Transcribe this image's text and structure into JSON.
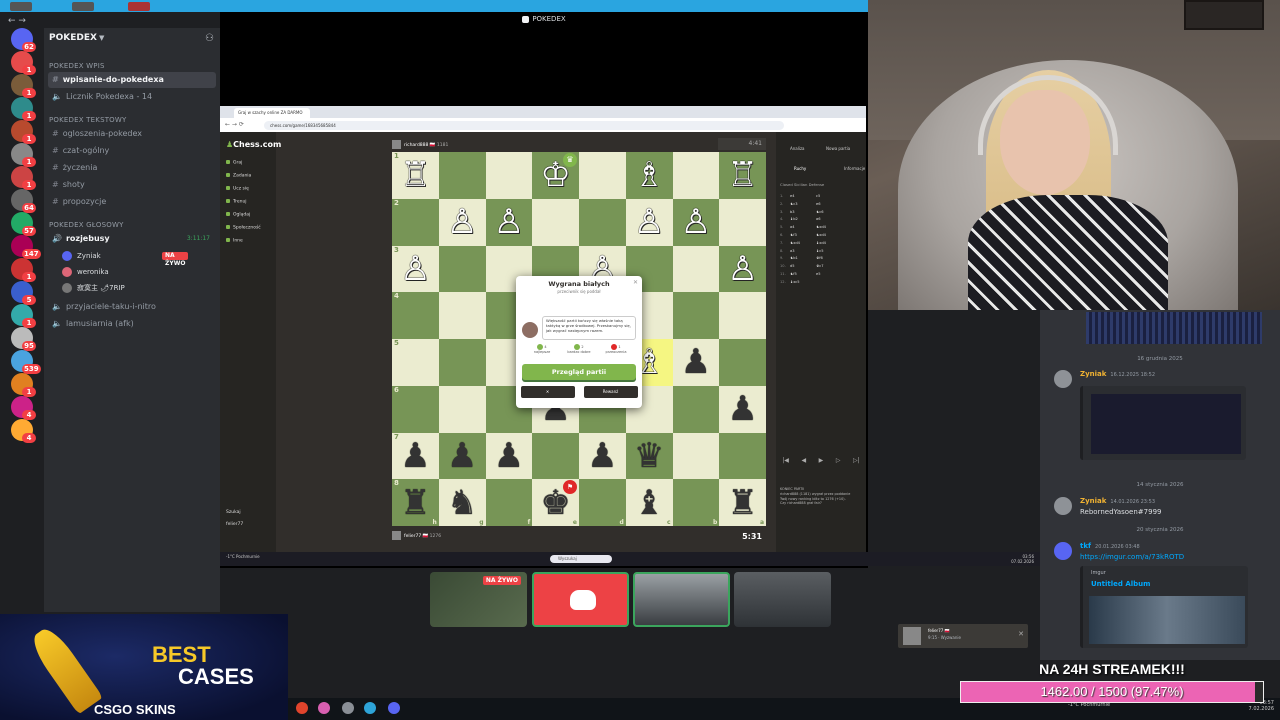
{
  "colors": {
    "discord_bg": "#1e1f22",
    "sidebar": "#2b2d31",
    "chat_bg": "#313338",
    "live_red": "#ed4245",
    "chess_light": "#ebecd0",
    "chess_dark": "#779556",
    "chess_green": "#81b64c",
    "goal_pink": "#ec64b4"
  },
  "server": {
    "name": "POKEDEX"
  },
  "rail_badges": [
    "62",
    "1",
    "1",
    "1",
    "1",
    "1",
    "1",
    "64",
    "57",
    "147",
    "1",
    "5",
    "1",
    "95",
    "539",
    "1",
    "4",
    "4"
  ],
  "categories": {
    "wpis": "POKEDEX Wpis",
    "tekstowy": "POKEDEX Tekstowy",
    "glosowy": "POKEDEX GŁOSOWY"
  },
  "channels": {
    "wpisanie": "wpisanie-do-pokedexa",
    "licznik": "Licznik Pokedexa - 14",
    "ogloszenia": "ogloszenia-pokedex",
    "czat": "czat-ogólny",
    "zyczenia": "życzenia",
    "shoty": "shoty",
    "propozycje": "propozycje",
    "voice": "rozjebusy",
    "voice_timer": "3:11:17",
    "przyjaciele": "przyjaciele-taku-i-nitro",
    "lamusiarnia": "lamusiarnia (afk)"
  },
  "voice_users": [
    {
      "name": "Zyniak",
      "live": "NA ŻYWO"
    },
    {
      "name": "weronika",
      "live": ""
    },
    {
      "name": "寂寞主 🌶7RIP",
      "live": ""
    }
  ],
  "stream": {
    "title": "POKEDEX"
  },
  "browser": {
    "tab_title": "Graj w szachy online ZA DARMO",
    "url": "chess.com/game/168345685844"
  },
  "chess": {
    "logo": "Chess.com",
    "nav": [
      "Graj",
      "Zadania",
      "Ucz się",
      "Trenuj",
      "Oglądaj",
      "Społeczność",
      "Inne"
    ],
    "nav_bottom": [
      "Szukaj",
      "felier77"
    ],
    "top_player": "richard888 🇵🇱",
    "top_rating": "1181",
    "top_clock": "4:41",
    "bottom_player": "felier77 🇵🇱",
    "bottom_rating": "1276",
    "bottom_clock": "5:31",
    "files": [
      "h",
      "g",
      "f",
      "e",
      "d",
      "c",
      "b",
      "a"
    ],
    "board": [
      [
        "♖",
        "",
        "",
        "♔",
        "",
        "♗",
        "",
        "♖"
      ],
      [
        "",
        "♙",
        "♙",
        "",
        "",
        "♙",
        "♙",
        ""
      ],
      [
        "♙",
        "",
        "",
        "",
        "♙",
        "",
        "",
        "♙"
      ],
      [
        "",
        "",
        "",
        "",
        "",
        "",
        "",
        ""
      ],
      [
        "",
        "",
        "",
        "",
        "",
        "♗",
        "♟",
        ""
      ],
      [
        "",
        "",
        "",
        "♟",
        "",
        "",
        "",
        "♟"
      ],
      [
        "♟",
        "♟",
        "♟",
        "",
        "♟",
        "♛",
        "",
        ""
      ],
      [
        "♜",
        "♞",
        "",
        "♚",
        "",
        "♝",
        "",
        "♜"
      ]
    ],
    "board_colors": [
      [
        "w",
        "b",
        "b",
        "w",
        "b",
        "w",
        "b",
        "w"
      ],
      [
        "w",
        "w",
        "w",
        "w",
        "w",
        "w",
        "w",
        "w"
      ],
      [
        "w",
        "w",
        "w",
        "w",
        "w",
        "w",
        "w",
        "w"
      ],
      [
        "",
        "",
        "",
        "",
        "",
        "",
        "",
        ""
      ],
      [
        "",
        "",
        "",
        "",
        "",
        "w",
        "b",
        ""
      ],
      [
        "",
        "",
        "",
        "b",
        "",
        "",
        "",
        "b"
      ],
      [
        "b",
        "b",
        "b",
        "",
        "b",
        "b",
        "",
        ""
      ],
      [
        "b",
        "b",
        "",
        "b",
        "",
        "b",
        "",
        "b"
      ]
    ],
    "modal": {
      "title": "Wygrana białych",
      "subtitle": "przeciwnik się poddał",
      "tip": "Większość partii kończy się właśnie taką taktyką w grze środkowej. Przeskanujmy się, jak wygrać następnym razem.",
      "stats": [
        {
          "value": "4",
          "label": "najlepsze",
          "color": "#81b64c"
        },
        {
          "value": "2",
          "label": "bardzo dobre",
          "color": "#81b64c"
        },
        {
          "value": "1",
          "label": "przeoczenia",
          "color": "#e02828"
        }
      ],
      "review": "Przegląd partii",
      "rematch": "Rewanż"
    },
    "panel": {
      "tab_analysis": "Analiza",
      "tab_new": "Nowa partia",
      "tab_moves": "Ruchy",
      "tab_info": "Informacje",
      "opening": "Closed Sicilian Defense",
      "moves": [
        [
          "1.",
          "e4",
          "c5"
        ],
        [
          "2.",
          "♞c3",
          "e6"
        ],
        [
          "3.",
          "b3",
          "♞c6"
        ],
        [
          "4.",
          "♝b2",
          "a6"
        ],
        [
          "5.",
          "a4",
          "♞xd4"
        ],
        [
          "6.",
          "♞f3",
          "♞xd4"
        ],
        [
          "7.",
          "♞xd4",
          "♝xd4"
        ],
        [
          "8.",
          "a3",
          "♝c5"
        ],
        [
          "9.",
          "♞b1",
          "♛f6"
        ],
        [
          "10.",
          "d5",
          "♛c7"
        ],
        [
          "11.",
          "♞f5",
          "e5"
        ],
        [
          "12.",
          "♝xc5",
          ""
        ]
      ],
      "chat": [
        "KONIEC PARTII",
        "richard888 (1181) wygrał przez poddanie",
        "Twój nowy ranking blitz to 1276 (+10).",
        "Czy richard888 grał fair?"
      ]
    },
    "notification": {
      "name": "felier77 🇵🇱",
      "status": "9:15 · Wyzwanie"
    }
  },
  "inner_taskbar": {
    "weather": "-1°C Pochmurnie",
    "search": "Wyszukaj",
    "time": "03:56",
    "date": "07.02.2026"
  },
  "tiles": [
    {
      "name": "chess-stream",
      "live": "NA ŻYWO"
    },
    {
      "name": "discord",
      "live": ""
    },
    {
      "name": "car",
      "live": ""
    },
    {
      "name": "person",
      "live": ""
    }
  ],
  "right_chat": {
    "divider1": "16 grudnia 2025",
    "msg1": {
      "user": "Zyniak",
      "time": "16.12.2025 18:52"
    },
    "divider2": "14 stycznia 2026",
    "msg2": {
      "user": "Zyniak",
      "time": "14.01.2026 23:53",
      "text": "RebornedYasoen#7999"
    },
    "divider3": "20 stycznia 2026",
    "msg3": {
      "user": "tkf",
      "time": "20.01.2026 03:48",
      "link": "https://imgur.com/a/73kROTD"
    },
    "embed": {
      "provider": "Imgur",
      "title": "Untitled Album"
    }
  },
  "ad": {
    "line1": "BEST",
    "line2": "CASES",
    "brand": "CSGO SKINS"
  },
  "goal": {
    "title": "NA 24H STREAMEK!!!",
    "text": "1462.00 / 1500 (97.47%)",
    "current": 1462,
    "target": 1500,
    "percent": 97.47
  },
  "host_taskbar": {
    "weather": "-1°C Pochmurnie",
    "time": "03:57",
    "date": "7.02.2026"
  }
}
